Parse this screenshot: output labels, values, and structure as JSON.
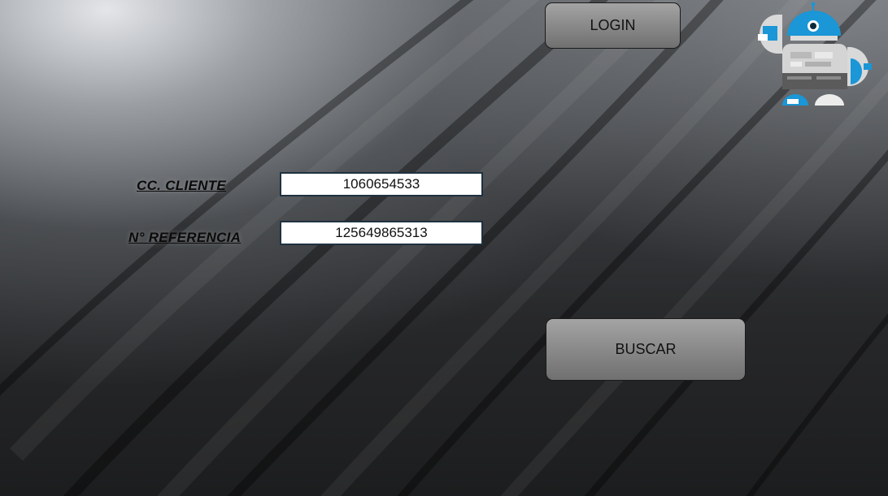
{
  "header": {
    "login_label": "LOGIN"
  },
  "form": {
    "cc_label": "CC. CLIENTE",
    "cc_value": "1060654533",
    "ref_label": "N° REFERENCIA",
    "ref_value": "125649865313",
    "search_label": "BUSCAR"
  },
  "icons": {
    "logo": "robot-logo-icon"
  },
  "colors": {
    "accent_blue": "#1b96d6",
    "button_gray": "#8c8c8c",
    "field_border": "#1f3140"
  }
}
